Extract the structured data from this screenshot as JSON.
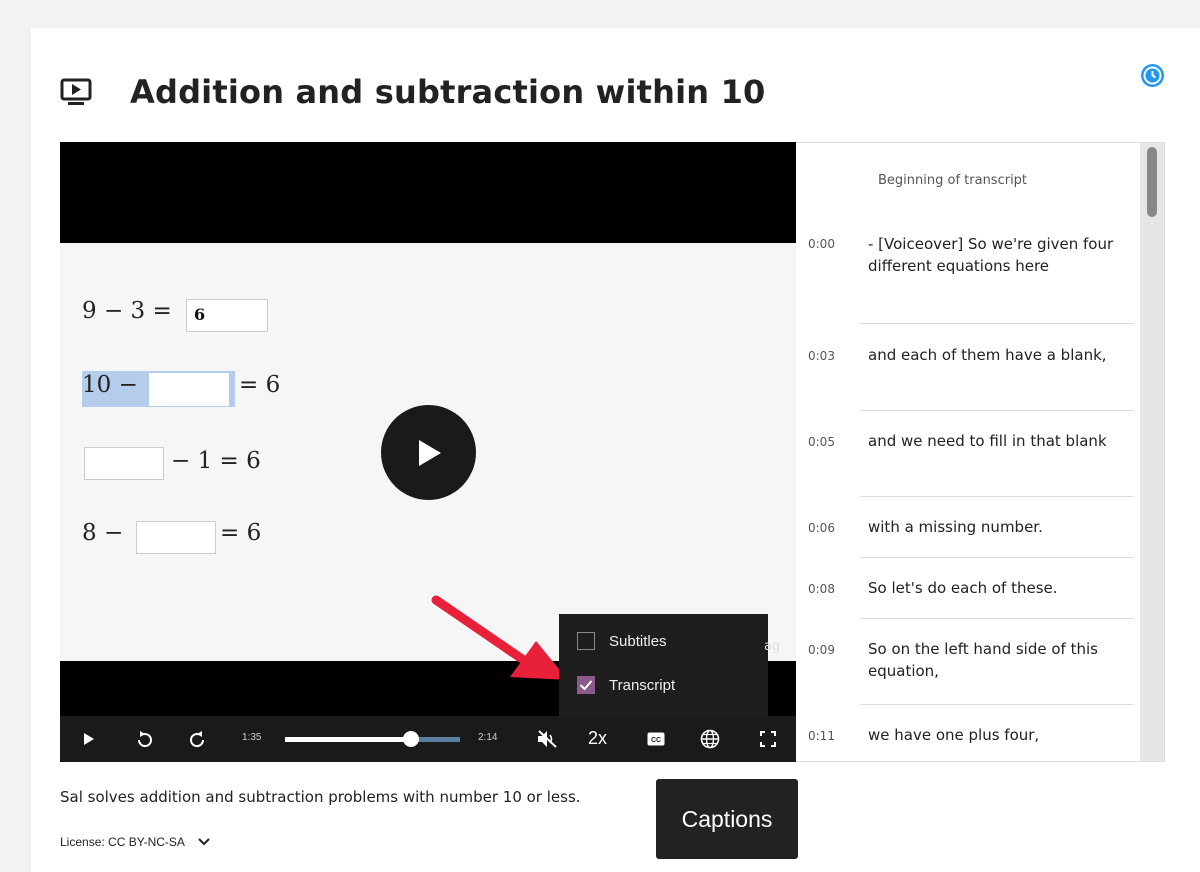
{
  "page": {
    "title": "Addition and subtraction within 10"
  },
  "video": {
    "equations": [
      {
        "left": "9 − 3 =",
        "box_value": "6"
      },
      {
        "left": "10 −",
        "right": "= 6"
      },
      {
        "right": "− 1 = 6"
      },
      {
        "left": "8 −",
        "right": "= 6"
      }
    ],
    "watermark": "ag"
  },
  "cc_menu": {
    "subtitles_label": "Subtitles",
    "subtitles_checked": false,
    "transcript_label": "Transcript",
    "transcript_checked": true
  },
  "controls": {
    "current_time": "1:35",
    "duration": "2:14",
    "progress": 0.72,
    "speed": "2x"
  },
  "transcript": {
    "heading": "Beginning of transcript",
    "entries": [
      {
        "time": "0:00",
        "text": "- [Voiceover] So we're given four different equations here"
      },
      {
        "time": "0:03",
        "text": "and each of them have a blank,"
      },
      {
        "time": "0:05",
        "text": "and we need to fill in that blank"
      },
      {
        "time": "0:06",
        "text": "with a missing number."
      },
      {
        "time": "0:08",
        "text": "So let's do each of these."
      },
      {
        "time": "0:09",
        "text": "So on the left hand side of this equation,"
      },
      {
        "time": "0:11",
        "text": "we have one plus four,"
      }
    ]
  },
  "description": "Sal solves addition and subtraction problems with number 10 or less.",
  "license": "License: CC BY-NC-SA",
  "tooltip": "Captions",
  "colors": {
    "accent_blue": "#2196f3",
    "arrow_red": "#e8203a",
    "checkbox_purple": "#8a5a8a",
    "seek_track": "#5a7fa0"
  }
}
